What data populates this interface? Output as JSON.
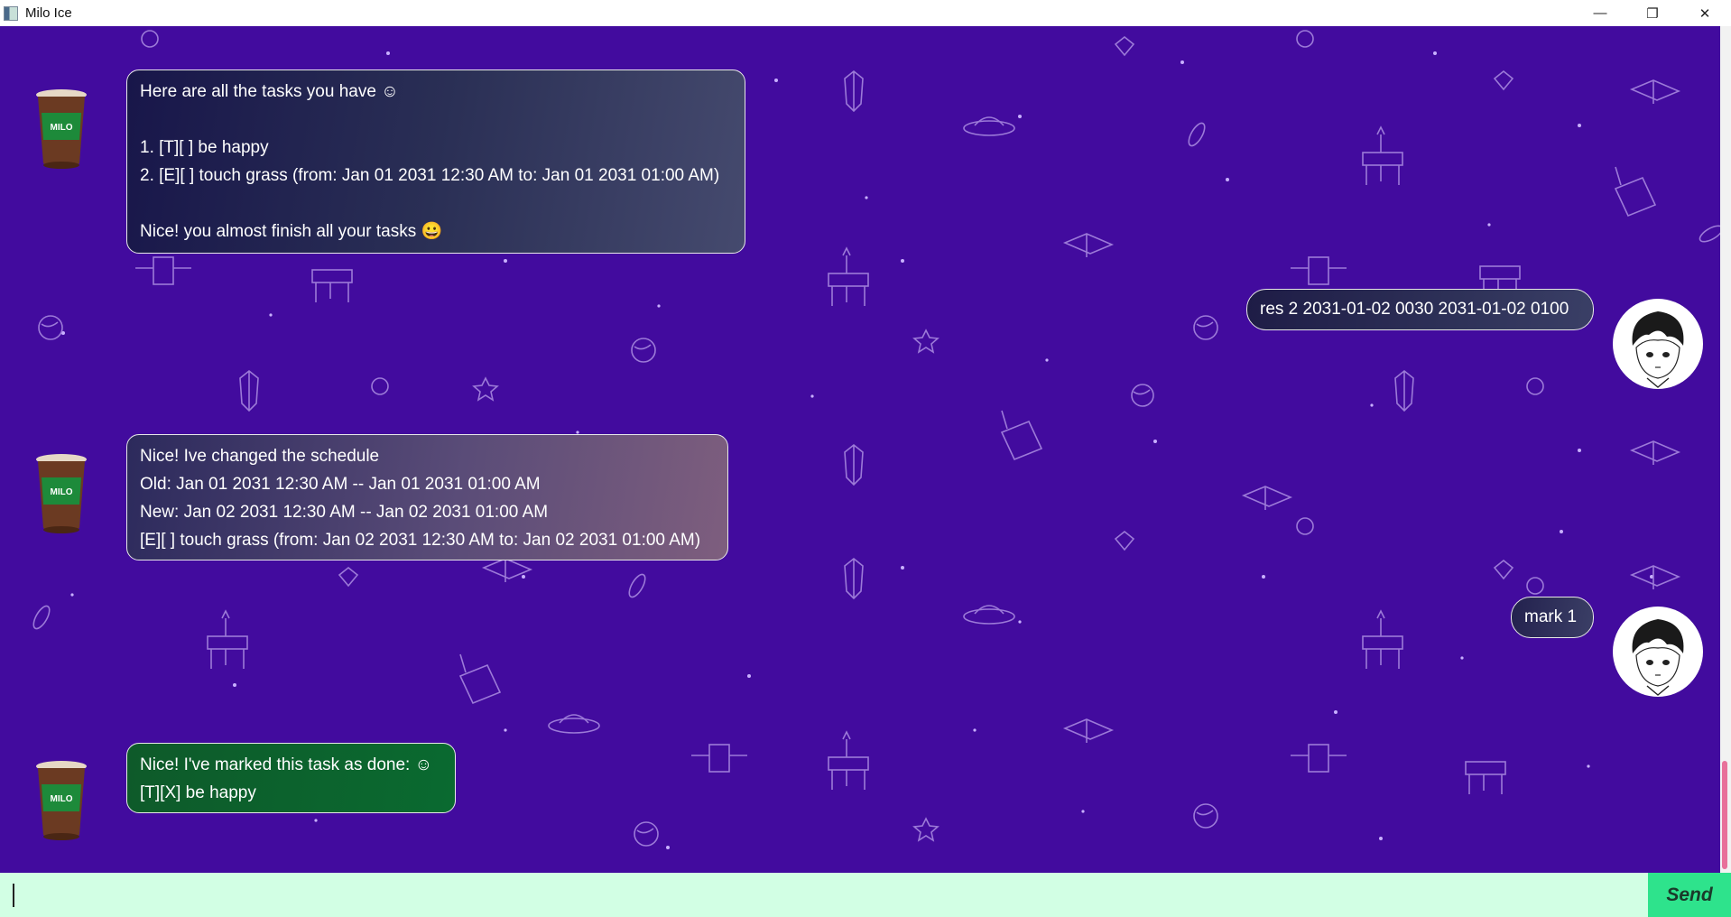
{
  "window": {
    "title": "Milo Ice",
    "minimize_glyph": "—",
    "restore_glyph": "❐",
    "close_glyph": "✕"
  },
  "messages": [
    {
      "sender": "bot",
      "text": "Here are all the tasks you have ☺\n\n1. [T][ ] be happy\n2. [E][ ] touch grass (from: Jan 01 2031 12:30 AM to: Jan 01 2031 01:00 AM)\n\nNice! you almost finish all your tasks 😀"
    },
    {
      "sender": "user",
      "text": "res 2 2031-01-02 0030 2031-01-02 0100"
    },
    {
      "sender": "bot",
      "text": "Nice! Ive changed the schedule\nOld: Jan 01 2031 12:30 AM -- Jan 01 2031 01:00 AM\nNew: Jan 02 2031 12:30 AM -- Jan 02 2031 01:00 AM\n[E][ ] touch grass (from: Jan 02 2031 12:30 AM to: Jan 02 2031 01:00 AM)"
    },
    {
      "sender": "user",
      "text": "mark 1"
    },
    {
      "sender": "bot",
      "text": "Nice! I've marked this task as done: ☺\n[T][X] be happy"
    }
  ],
  "input": {
    "value": "",
    "placeholder": ""
  },
  "send_button": {
    "label": "Send"
  },
  "colors": {
    "background": "#420b9e",
    "doodle": "#9c7ad8",
    "input": "#d2ffe4",
    "send": "#2ee38c",
    "done_bubble": "#0a6a30"
  },
  "icons": {
    "bot_avatar": "milo-iced-drink-cup",
    "user_avatar": "sketched-boy-face"
  }
}
